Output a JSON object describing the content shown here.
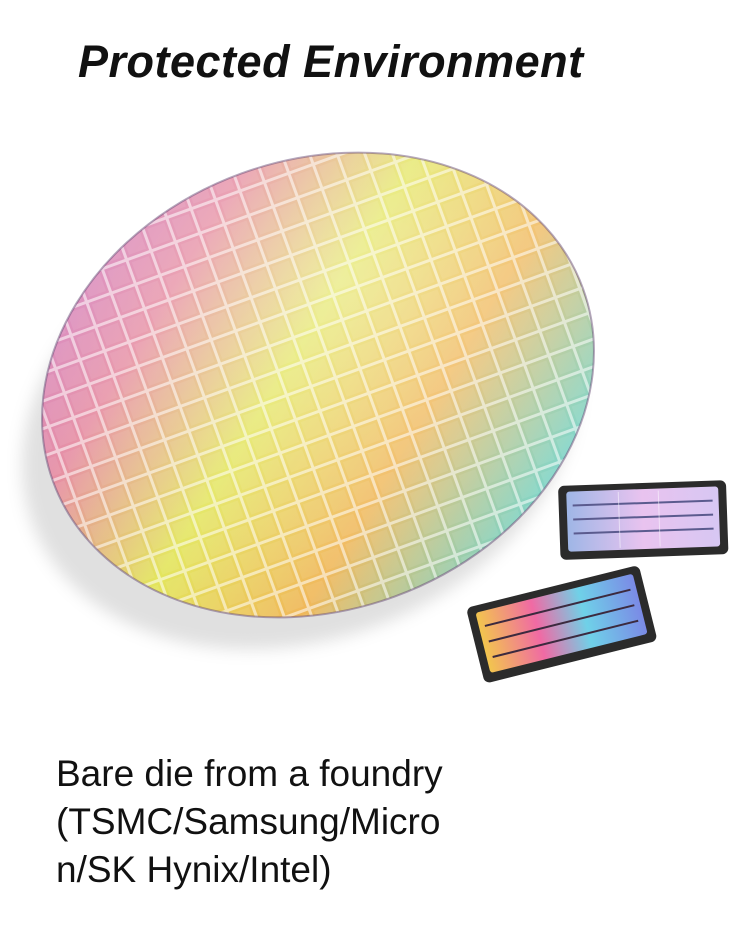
{
  "slide": {
    "title": "Protected Environment",
    "illustration": {
      "subject": "silicon wafer with die grid and two bare die chips",
      "wafer_colors": [
        "#c77ad6",
        "#e3e55c",
        "#f0b85a",
        "#7fd3c4",
        "#e58aa0"
      ]
    },
    "caption_lines": [
      "Bare die from a foundry",
      "(TSMC/Samsung/Micro",
      "n/SK Hynix/Intel)"
    ]
  }
}
